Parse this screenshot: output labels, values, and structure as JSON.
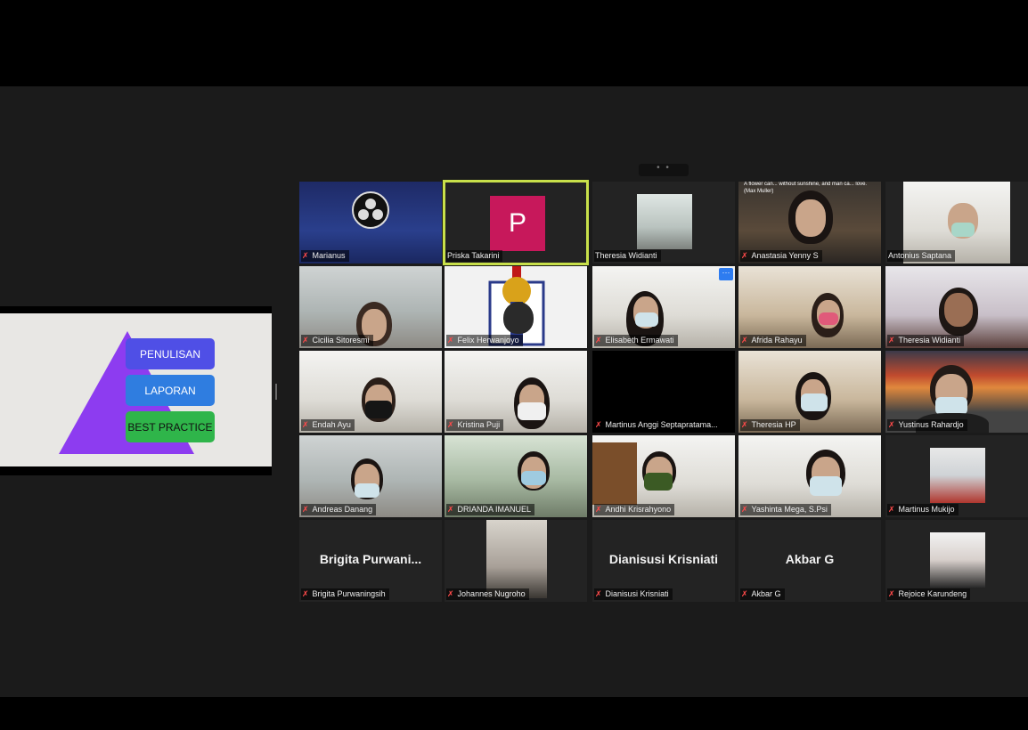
{
  "slide": {
    "boxes": [
      "PENULISAN",
      "LAPORAN",
      "BEST PRACTICE"
    ]
  },
  "colors": {
    "active_speaker_border": "#c8e04a",
    "avatar_p": "#c7185b",
    "muted_icon": "#ff4a4a"
  },
  "participants": [
    {
      "name": "Marianus"
    },
    {
      "name": "Priska Takarini",
      "avatar_letter": "P"
    },
    {
      "name": "Theresia Widianti"
    },
    {
      "name": "Anastasia Yenny S"
    },
    {
      "name": "Antonius Saptana"
    },
    {
      "name": "Cicilia Sitoresmi"
    },
    {
      "name": "Felix Herwanjoyo"
    },
    {
      "name": "Elisabeth Ermawati"
    },
    {
      "name": "Afrida Rahayu"
    },
    {
      "name": "Theresia Widianti"
    },
    {
      "name": "Endah Ayu"
    },
    {
      "name": "Kristina Puji"
    },
    {
      "name": "Martinus Anggi Septapratama..."
    },
    {
      "name": "Theresia HP"
    },
    {
      "name": "Yustinus Rahardjo"
    },
    {
      "name": "Andreas Danang"
    },
    {
      "name": "DRIANDA IMANUEL"
    },
    {
      "name": "Andhi Krisrahyono"
    },
    {
      "name": "Yashinta Mega, S.Psi"
    },
    {
      "name": "Martinus Mukijo"
    },
    {
      "name": "Brigita Purwaningsih",
      "display_name": "Brigita  Purwani..."
    },
    {
      "name": "Johannes Nugroho"
    },
    {
      "name": "Dianisusi Krisniati",
      "display_name": "Dianisusi Krisniati"
    },
    {
      "name": "Akbar G",
      "display_name": "Akbar G"
    },
    {
      "name": "Rejoice Karundeng"
    }
  ],
  "quote_text": "A flower can... without sunshine, and man ca... love.",
  "quote_author": "(Max Muller)",
  "top_handle": "• •",
  "more_button": "···"
}
